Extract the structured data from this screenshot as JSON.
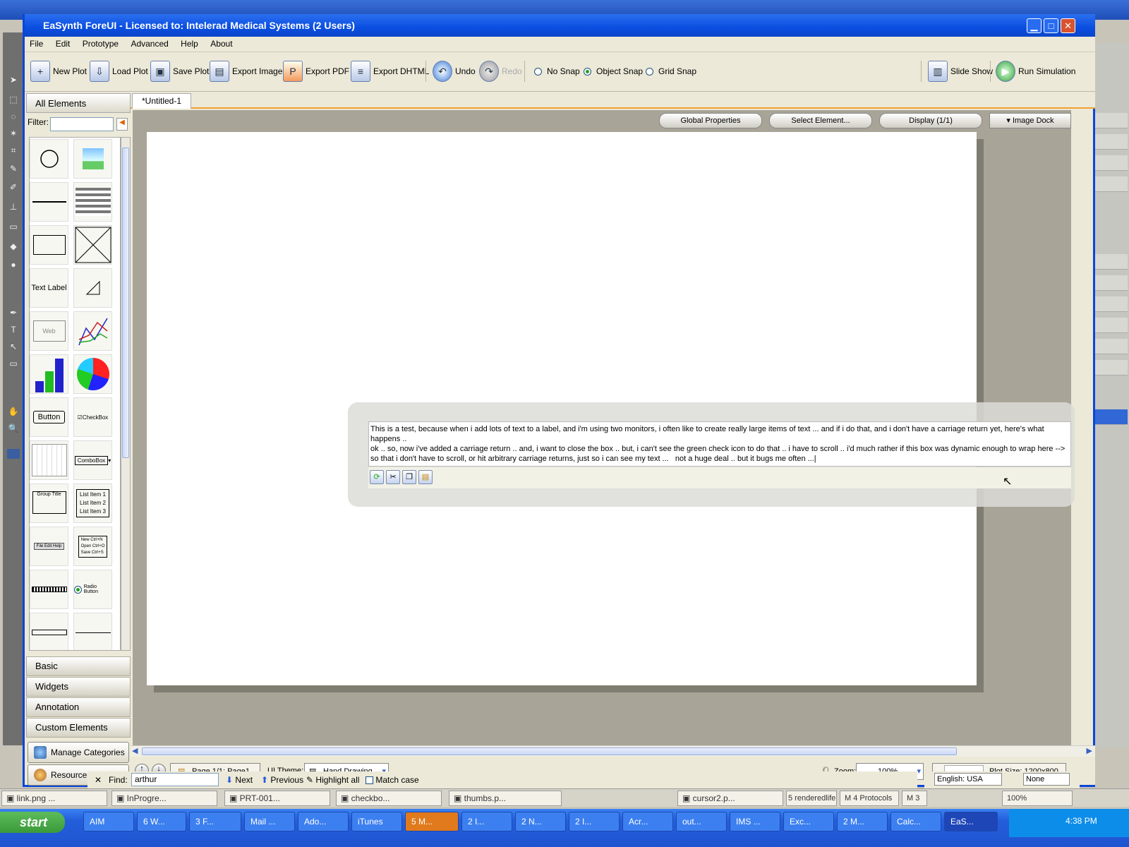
{
  "window": {
    "title": "EaSynth ForeUI - Licensed to: Intelerad Medical Systems (2 Users)"
  },
  "menu": [
    "File",
    "Edit",
    "Prototype",
    "Advanced",
    "Help",
    "About"
  ],
  "toolbar": {
    "new_plot": "New Plot",
    "load_plot": "Load Plot",
    "save_plot": "Save Plot",
    "export_image": "Export Image",
    "export_pdf": "Export PDF",
    "export_dhtml": "Export DHTML",
    "undo": "Undo",
    "redo": "Redo",
    "no_snap": "No Snap",
    "object_snap": "Object Snap",
    "grid_snap": "Grid Snap",
    "slide_show": "Slide Show",
    "run_simulation": "Run Simulation"
  },
  "left_panel": {
    "header": "All Elements",
    "filter_label": "Filter:",
    "filter_value": "",
    "palette": [
      "circle",
      "image",
      "line",
      "blur-line",
      "rectangle",
      "placeholder",
      "Text Label",
      "triangle",
      "Web",
      "line-chart",
      "bar-chart",
      "pie-chart",
      "Button",
      "CheckBox",
      "calendar",
      "ComboBox",
      "Group Title",
      "List Item",
      "menu-bar",
      "menu",
      "progress-bar",
      "Radio Button",
      "scrollbar",
      "slider"
    ],
    "palette_labels": {
      "text_label": "Text Label",
      "web": "Web",
      "button": "Button",
      "checkbox": "CheckBox",
      "combobox": "ComboBox",
      "group_title": "Group Title",
      "list1": "List Item 1",
      "list2": "List Item 2",
      "list3": "List Item 3",
      "radio": "Radio Button",
      "menu_new": "New   Ctrl+N",
      "menu_open": "Open  Ctrl+O",
      "menu_save": "Save  Ctrl+S",
      "menubar": "File  Edit  Help"
    },
    "categories": [
      "Basic",
      "Widgets",
      "Annotation",
      "Custom Elements"
    ],
    "manage_categories": "Manage Categories",
    "resource_sharing": "Resource Sharing"
  },
  "editor": {
    "tab": "*Untitled-1",
    "global_properties": "Global Properties",
    "select_element": "Select Element...",
    "display": "Display (1/1)",
    "image_dock": "Image Dock",
    "text_value": "This is a test, because when i add lots of text to a label, and i'm using two monitors, i often like to create really large items of text ... and if i do that, and i don't have a carriage return yet, here's what happens ..\nok .. so, now i've added a carriage return .. and, i want to close the box .. but, i can't see the green check icon to do that .. i have to scroll .. i'd much rather if this box was dynamic enough to wrap here -->\nso that i don't have to scroll, or hit arbitrary carriage returns, just so i can see my text ...   not a huge deal .. but it bugs me often ...|"
  },
  "status": {
    "page": "Page 1/1: Page1",
    "ui_theme_label": "UI Theme:",
    "ui_theme": "Hand Drawing",
    "zoom_label": "Zoom:",
    "zoom": "100%",
    "plot_size": "Plot Size: 1200x800"
  },
  "findbar": {
    "label": "Find:",
    "value": "arthur",
    "next": "Next",
    "previous": "Previous",
    "highlight": "Highlight all",
    "match_case": "Match case"
  },
  "file_tabs": [
    "link.png ...",
    "InProgre...",
    "PRT-001...",
    "checkbo...",
    "thumbs.p...",
    "cursor2.p..."
  ],
  "file_tabs_right": [
    "5 renderedlife",
    "4 Protocols",
    "3"
  ],
  "ps_status": {
    "lang": "English: USA",
    "aa": "None",
    "zoom": "100%"
  },
  "taskbar": {
    "start": "start",
    "items": [
      "AIM",
      "6 W...",
      "3 F...",
      "Mail ...",
      "Ado...",
      "iTunes",
      "5 M...",
      "2 I...",
      "2 N...",
      "2 I...",
      "Acr...",
      "out...",
      "IMS ...",
      "Exc...",
      "2 M...",
      "Calc...",
      "EaS..."
    ],
    "clock": "4:38 PM"
  }
}
